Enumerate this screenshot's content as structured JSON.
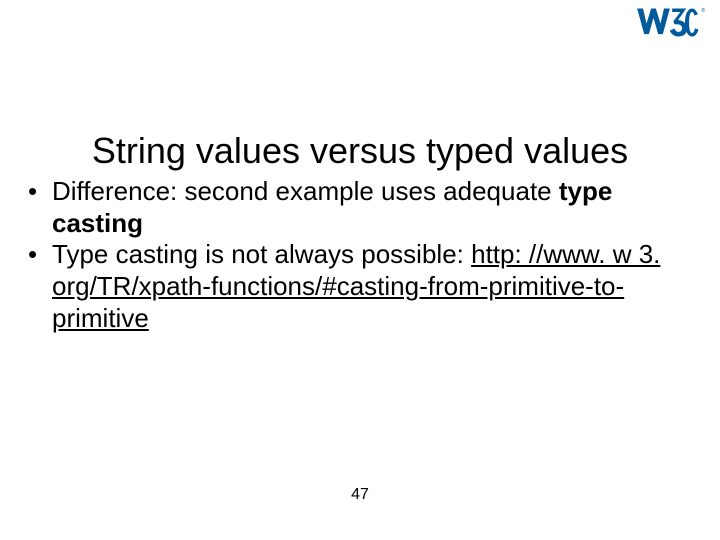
{
  "logo": {
    "name": "w3c-logo"
  },
  "title": "String values versus typed values",
  "bullets": [
    {
      "prefix": "Difference: second example uses adequate ",
      "bold": "type casting",
      "suffix": ""
    },
    {
      "prefix": "Type casting is not always possible: ",
      "link": "http: //www. w 3. org/TR/xpath-functions/#casting-from-primitive-to-primitive"
    }
  ],
  "page_number": "47"
}
